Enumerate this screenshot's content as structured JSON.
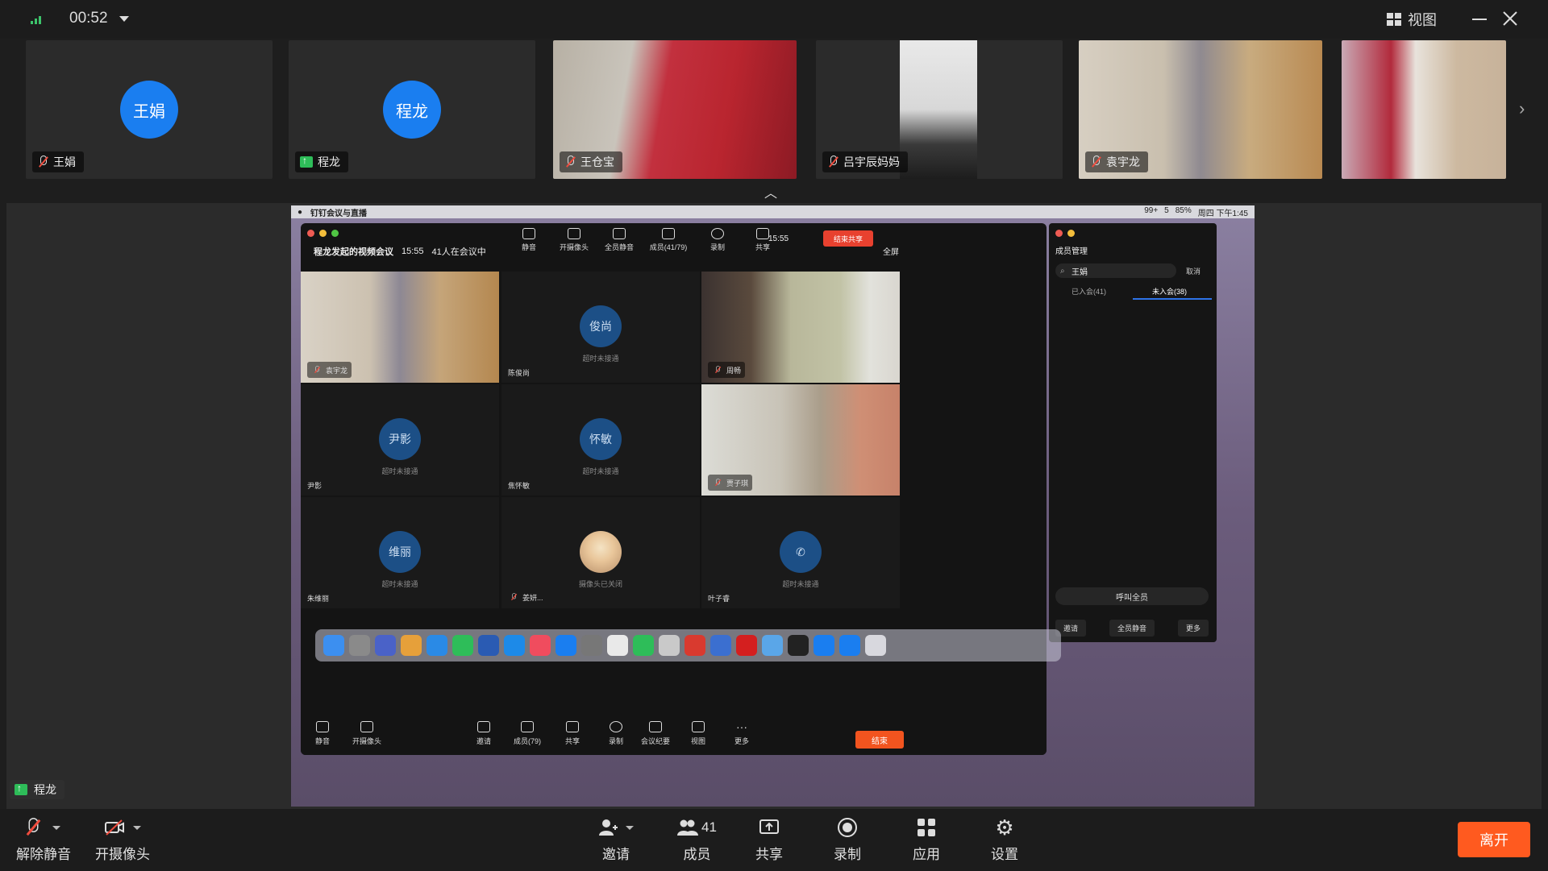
{
  "topbar": {
    "timer": "00:52",
    "view_label": "视图"
  },
  "thumbnails": [
    {
      "name": "王娟",
      "avatar_text": "王娟",
      "muted": true,
      "camera": false
    },
    {
      "name": "程龙",
      "avatar_text": "程龙",
      "sharing": true,
      "camera": false
    },
    {
      "name": "王仓宝",
      "muted": true,
      "camera": true
    },
    {
      "name": "吕宇辰妈妈",
      "muted": true,
      "camera": true
    },
    {
      "name": "袁宇龙",
      "muted": true,
      "camera": true
    },
    {
      "name": "",
      "camera": true
    }
  ],
  "shared_screen": {
    "mac_app_name": "钉钉会议与直播",
    "mac_status": "周四 下午1:45",
    "mac_battery": "85%",
    "mac_badge1": "99+",
    "mac_badge2": "5",
    "meeting_title": "程龙发起的视频会议",
    "meeting_time": "15:55",
    "meeting_count": "41人在会议中",
    "toolbar": [
      "静音",
      "开摄像头",
      "全员静音",
      "成员(41/79)",
      "录制",
      "共享"
    ],
    "clock": "15:55",
    "end_share": "结束共享",
    "fullscreen": "全屏",
    "tiles": [
      {
        "name": "袁宇龙",
        "video": true
      },
      {
        "name": "陈俊尚",
        "circle": "俊尚",
        "status": "超时未接通"
      },
      {
        "name": "周畅",
        "video": true
      },
      {
        "name": "尹影",
        "circle": "尹影",
        "status": "超时未接通"
      },
      {
        "name": "焦怀敏",
        "circle": "怀敏",
        "status": "超时未接通"
      },
      {
        "name": "贾子琪",
        "video": true
      },
      {
        "name": "朱维丽",
        "circle": "维丽",
        "status": "超时未接通"
      },
      {
        "name": "姜妍...",
        "circle": "",
        "status": "摄像头已关闭"
      },
      {
        "name": "叶子睿",
        "circle": "",
        "status": "超时未接通"
      }
    ],
    "bottom_toolbar": [
      "静音",
      "开摄像头",
      "邀请",
      "成员(79)",
      "共享",
      "录制",
      "会议纪要",
      "视图",
      "更多"
    ],
    "end_label": "结束",
    "member_panel": {
      "title": "成员管理",
      "search_value": "王娟",
      "cancel": "取消",
      "tab_joined": "已入会(41)",
      "tab_not_joined": "未入会(38)",
      "call_all": "呼叫全员",
      "actions": [
        "邀请",
        "全员静音",
        "更多"
      ]
    }
  },
  "presenter_tag": "程龙",
  "bottombar": {
    "unmute": "解除静音",
    "camera": "开摄像头",
    "invite": "邀请",
    "members": "成员",
    "members_count": "41",
    "share": "共享",
    "record": "录制",
    "apps": "应用",
    "settings": "设置",
    "leave": "离开"
  },
  "colors": {
    "accent_blue": "#1a7ef0",
    "leave_orange": "#ff5a1f",
    "share_green": "#2ebd59",
    "end_red": "#e8412f"
  }
}
